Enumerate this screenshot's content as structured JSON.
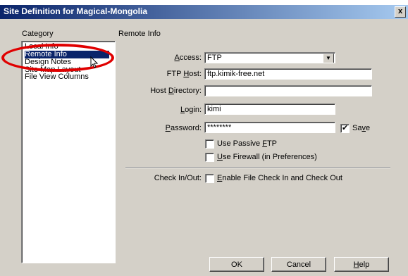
{
  "window": {
    "title": "Site Definition for Magical-Mongolia",
    "close_glyph": "x"
  },
  "category": {
    "header": "Category",
    "items": [
      "Local Info",
      "Remote Info",
      "Design Notes",
      "Site Map Layout",
      "File View Columns"
    ],
    "selected_index": 1
  },
  "remote_info": {
    "header": "Remote Info",
    "access": {
      "label_pre": "",
      "label_u": "A",
      "label_post": "ccess:",
      "value": "FTP"
    },
    "ftp_host": {
      "label_pre": "FTP ",
      "label_u": "H",
      "label_post": "ost:",
      "value": "ftp.kimik-free.net"
    },
    "host_directory": {
      "label_pre": "Host ",
      "label_u": "D",
      "label_post": "irectory:",
      "value": ""
    },
    "login": {
      "label_pre": "",
      "label_u": "L",
      "label_post": "ogin:",
      "value": "kimi"
    },
    "password": {
      "label_pre": "",
      "label_u": "P",
      "label_post": "assword:",
      "value": "********"
    },
    "save": {
      "label_pre": "Sa",
      "label_u": "v",
      "label_post": "e",
      "checked": true
    },
    "passive_ftp": {
      "label_pre": "Use Passive ",
      "label_u": "F",
      "label_post": "TP",
      "checked": false
    },
    "firewall": {
      "label_pre": "",
      "label_u": "U",
      "label_post": "se Firewall (in Preferences)",
      "checked": false
    },
    "check_in_out": {
      "label": "Check In/Out:",
      "option_pre": "",
      "option_u": "E",
      "option_post": "nable File Check In and Check Out",
      "checked": false
    }
  },
  "buttons": {
    "ok": "OK",
    "cancel": "Cancel",
    "help_u": "H",
    "help_post": "elp"
  },
  "annotation_color": "#e00000"
}
